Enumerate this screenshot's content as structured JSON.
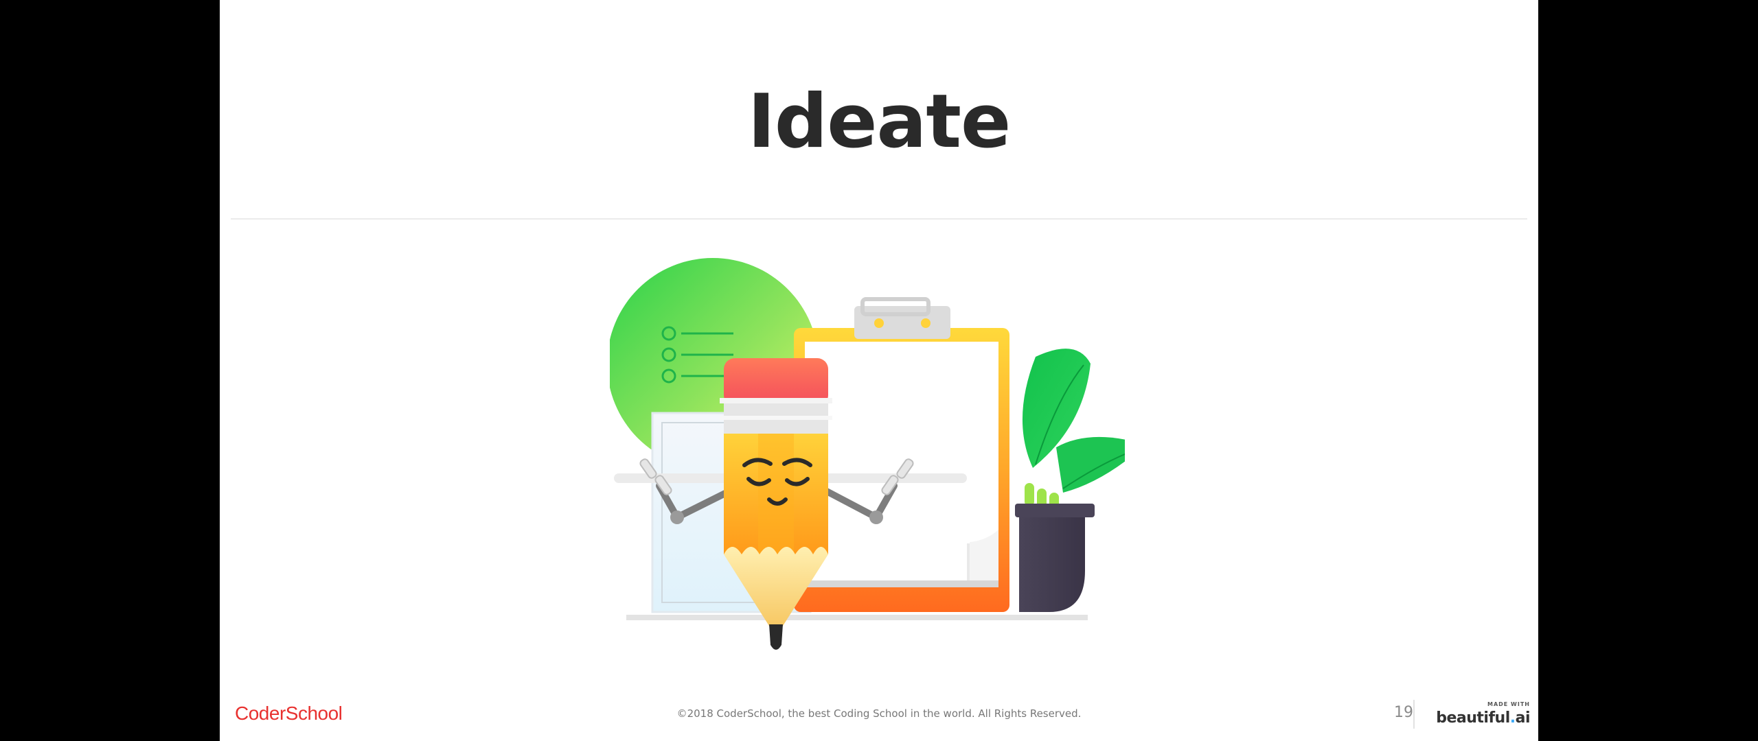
{
  "slide": {
    "title": "Ideate",
    "page_number": "19",
    "background_color": "#ffffff"
  },
  "illustration": {
    "subject": "pencil-character-with-clipboard-icon"
  },
  "footer": {
    "logo_text": "CoderSchool",
    "logo_color": "#e8312f",
    "copyright": "©2018 CoderSchool, the best Coding School in the world. All Rights Reserved.",
    "made_with_label": "MADE WITH",
    "brand_name": "beautiful",
    "brand_dot": ".",
    "brand_suffix": "ai"
  }
}
